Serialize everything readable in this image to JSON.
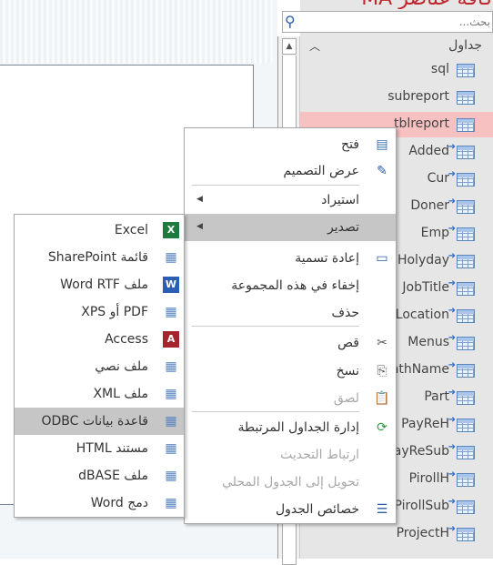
{
  "navpane": {
    "title": "كافة عناصر MA",
    "search_placeholder": "بحث...",
    "group_label": "جداول",
    "items": [
      {
        "name": "sql",
        "linked": false
      },
      {
        "name": "subreport",
        "linked": false
      },
      {
        "name": "tblreport",
        "linked": false,
        "selected": true
      },
      {
        "name": "Added",
        "linked": true
      },
      {
        "name": "Cur",
        "linked": true
      },
      {
        "name": "Doner",
        "linked": true
      },
      {
        "name": "Emp",
        "linked": true
      },
      {
        "name": "Holyday",
        "linked": true
      },
      {
        "name": "JobTitle",
        "linked": true
      },
      {
        "name": "Location",
        "linked": true
      },
      {
        "name": "Menus",
        "linked": true
      },
      {
        "name": "onthName",
        "linked": true
      },
      {
        "name": "Part",
        "linked": true
      },
      {
        "name": "PayReH",
        "linked": true
      },
      {
        "name": "PayReSub",
        "linked": true
      },
      {
        "name": "PirollH",
        "linked": true
      },
      {
        "name": "PirollSub",
        "linked": true
      },
      {
        "name": "ProjectH",
        "linked": true
      }
    ]
  },
  "context_menu": {
    "items": [
      {
        "label": "فتح",
        "icon": "open-icon"
      },
      {
        "label": "عرض التصميم",
        "icon": "design-view-icon"
      },
      {
        "label": "استيراد",
        "submenu": true
      },
      {
        "label": "تصدير",
        "submenu": true,
        "highlighted": true
      },
      {
        "label": "إعادة تسمية",
        "icon": "rename-icon"
      },
      {
        "label": "إخفاء في هذه المجموعة"
      },
      {
        "label": "حذف"
      },
      {
        "label": "قص",
        "icon": "scissors-icon"
      },
      {
        "label": "نسخ",
        "icon": "copy-icon"
      },
      {
        "label": "لصق",
        "icon": "paste-icon",
        "disabled": true
      },
      {
        "label": "إدارة الجداول المرتبطة",
        "icon": "linked-table-manager-icon"
      },
      {
        "label": "ارتباط التحديث",
        "disabled": true
      },
      {
        "label": "تحويل إلى الجدول المحلي",
        "disabled": true
      },
      {
        "label": "خصائص الجدول",
        "icon": "properties-icon"
      }
    ]
  },
  "export_submenu": {
    "items": [
      {
        "label": "Excel",
        "icon": "excel-icon"
      },
      {
        "label": "قائمة SharePoint",
        "icon": "sharepoint-list-icon"
      },
      {
        "label": "ملف Word RTF",
        "icon": "word-icon"
      },
      {
        "label": "PDF أو XPS",
        "icon": "pdf-icon"
      },
      {
        "label": "Access",
        "icon": "access-icon"
      },
      {
        "label": "ملف نصي",
        "icon": "text-file-icon"
      },
      {
        "label": "ملف XML",
        "icon": "xml-icon"
      },
      {
        "label": "قاعدة بيانات ODBC",
        "icon": "odbc-icon",
        "highlighted": true
      },
      {
        "label": "مستند HTML",
        "icon": "html-icon"
      },
      {
        "label": "ملف dBASE",
        "icon": "dbase-icon"
      },
      {
        "label": "دمج Word",
        "icon": "word-merge-icon"
      }
    ]
  },
  "colors": {
    "selected_item": "#f7c1c1",
    "menu_highlight": "#c6c6c6",
    "title": "#c0272d"
  }
}
